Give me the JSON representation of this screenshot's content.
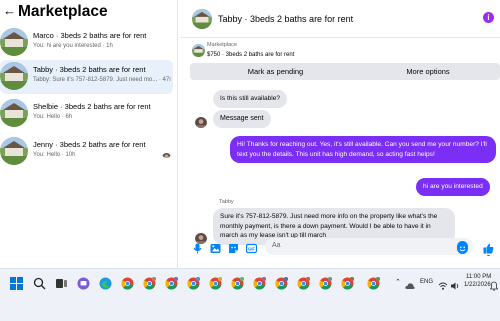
{
  "left_panel": {
    "title": "Marketplace",
    "conversations": [
      {
        "name": "Marco · 3beds 2 baths are for rent",
        "preview": "You: hi are you interested · 1h"
      },
      {
        "name": "Tabby · 3beds 2 baths are for rent",
        "preview": "Tabby: Sure it's 757-812-5879. Just need mo... · 47m"
      },
      {
        "name": "Shelbie · 3beds 2 baths are for rent",
        "preview": "You: Hello · 6h"
      },
      {
        "name": "Jenny · 3beds 2 baths are for rent",
        "preview": "You: Hello · 10h"
      }
    ]
  },
  "chat": {
    "title": "Tabby · 3beds 2 baths are for rent",
    "listing_label": "Marketplace",
    "listing_info": "$750 · 3beds 2 baths are for rent",
    "mark_pending_label": "Mark as pending",
    "more_options_label": "More options",
    "messages": [
      {
        "dir": "in",
        "text": "Is this still available?"
      },
      {
        "dir": "in",
        "text": "Message sent"
      },
      {
        "dir": "out",
        "text": "Hi! Thanks for reaching out. Yes, it's still available. Can you send me your number? I'll text you the details. This unit has high demand, so acting fast helps!"
      },
      {
        "dir": "out",
        "text": "hi are you interested"
      },
      {
        "dir": "in",
        "sender": "Tabby",
        "text": "Sure it's 757-812-5879. Just need more info on the property like what's the monthly payment, is there a down payment. Would I be able to have it in march as my lease isn't up till march"
      }
    ],
    "composer_placeholder": "Aa"
  },
  "taskbar": {
    "language": "ENG",
    "time": "11:00 PM",
    "date": "1/22/2026"
  },
  "colors": {
    "accent_purple": "#7b2ef5",
    "messenger_blue": "#0084ff",
    "active_row": "#e7f0fb"
  }
}
